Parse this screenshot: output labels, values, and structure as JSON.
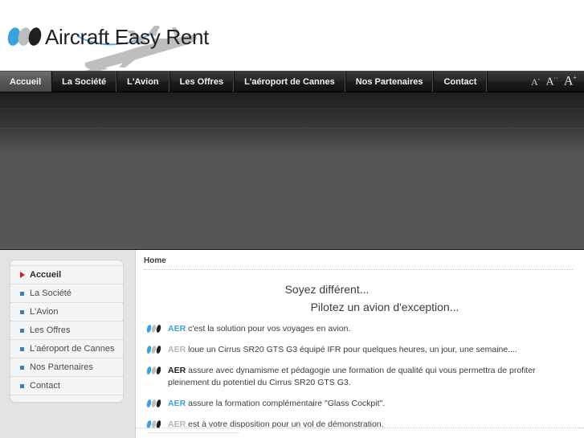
{
  "site": {
    "logo_text": "Aircraft Easy Rent",
    "logo_dot_colors": [
      "#3aa3dc",
      "#bcbec0",
      "#231f20"
    ],
    "swoosh_color": "#5aaedd",
    "plane_watermark_color": "#b9bbbd"
  },
  "navbar": {
    "items": [
      {
        "label": "Accueil",
        "active": true
      },
      {
        "label": "La Société",
        "active": false
      },
      {
        "label": "L'Avion",
        "active": false
      },
      {
        "label": "Les Offres",
        "active": false
      },
      {
        "label": "L'aéroport de Cannes",
        "active": false
      },
      {
        "label": "Nos Partenaires",
        "active": false
      },
      {
        "label": "Contact",
        "active": false
      }
    ],
    "font_tools": {
      "decrease": "A",
      "decrease_sup": "-",
      "reset": "A",
      "reset_sup": "··",
      "increase": "A",
      "increase_sup": "+"
    }
  },
  "sidebar": {
    "items": [
      {
        "label": "Accueil",
        "active": true
      },
      {
        "label": "La Société",
        "active": false
      },
      {
        "label": "L'Avion",
        "active": false
      },
      {
        "label": "Les Offres",
        "active": false
      },
      {
        "label": "L'aéroport de Cannes",
        "active": false
      },
      {
        "label": "Nos Partenaires",
        "active": false
      },
      {
        "label": "Contact",
        "active": false
      }
    ],
    "bullet_color": "#3d7ebd",
    "active_arrow_color": "#cf2222"
  },
  "main": {
    "breadcrumb": "Home",
    "headline_line1": "Soyez différent...",
    "headline_line2": "Pilotez un avion d'exception...",
    "bullets": [
      {
        "brand": "AER",
        "brand_style": "blue",
        "text": "c'est la solution pour vos voyages en avion."
      },
      {
        "brand": "AER",
        "brand_style": "grey",
        "text": "loue un Cirrus SR20 GTS G3 équipé IFR pour quelques heures, un jour, une semaine...."
      },
      {
        "brand": "AER",
        "brand_style": "black",
        "text": "assure avec dynamisme et pédagogie une formation de qualité qui vous permettra de profiter pleinement du potentiel du Cirrus SR20 GTS G3."
      },
      {
        "brand": "AER",
        "brand_style": "blue",
        "text": "assure la formation complémentaire \"Glass Cockpit\"."
      },
      {
        "brand": "AER",
        "brand_style": "grey",
        "text": "est à votre disposition pour un vol de démonstration."
      }
    ]
  }
}
